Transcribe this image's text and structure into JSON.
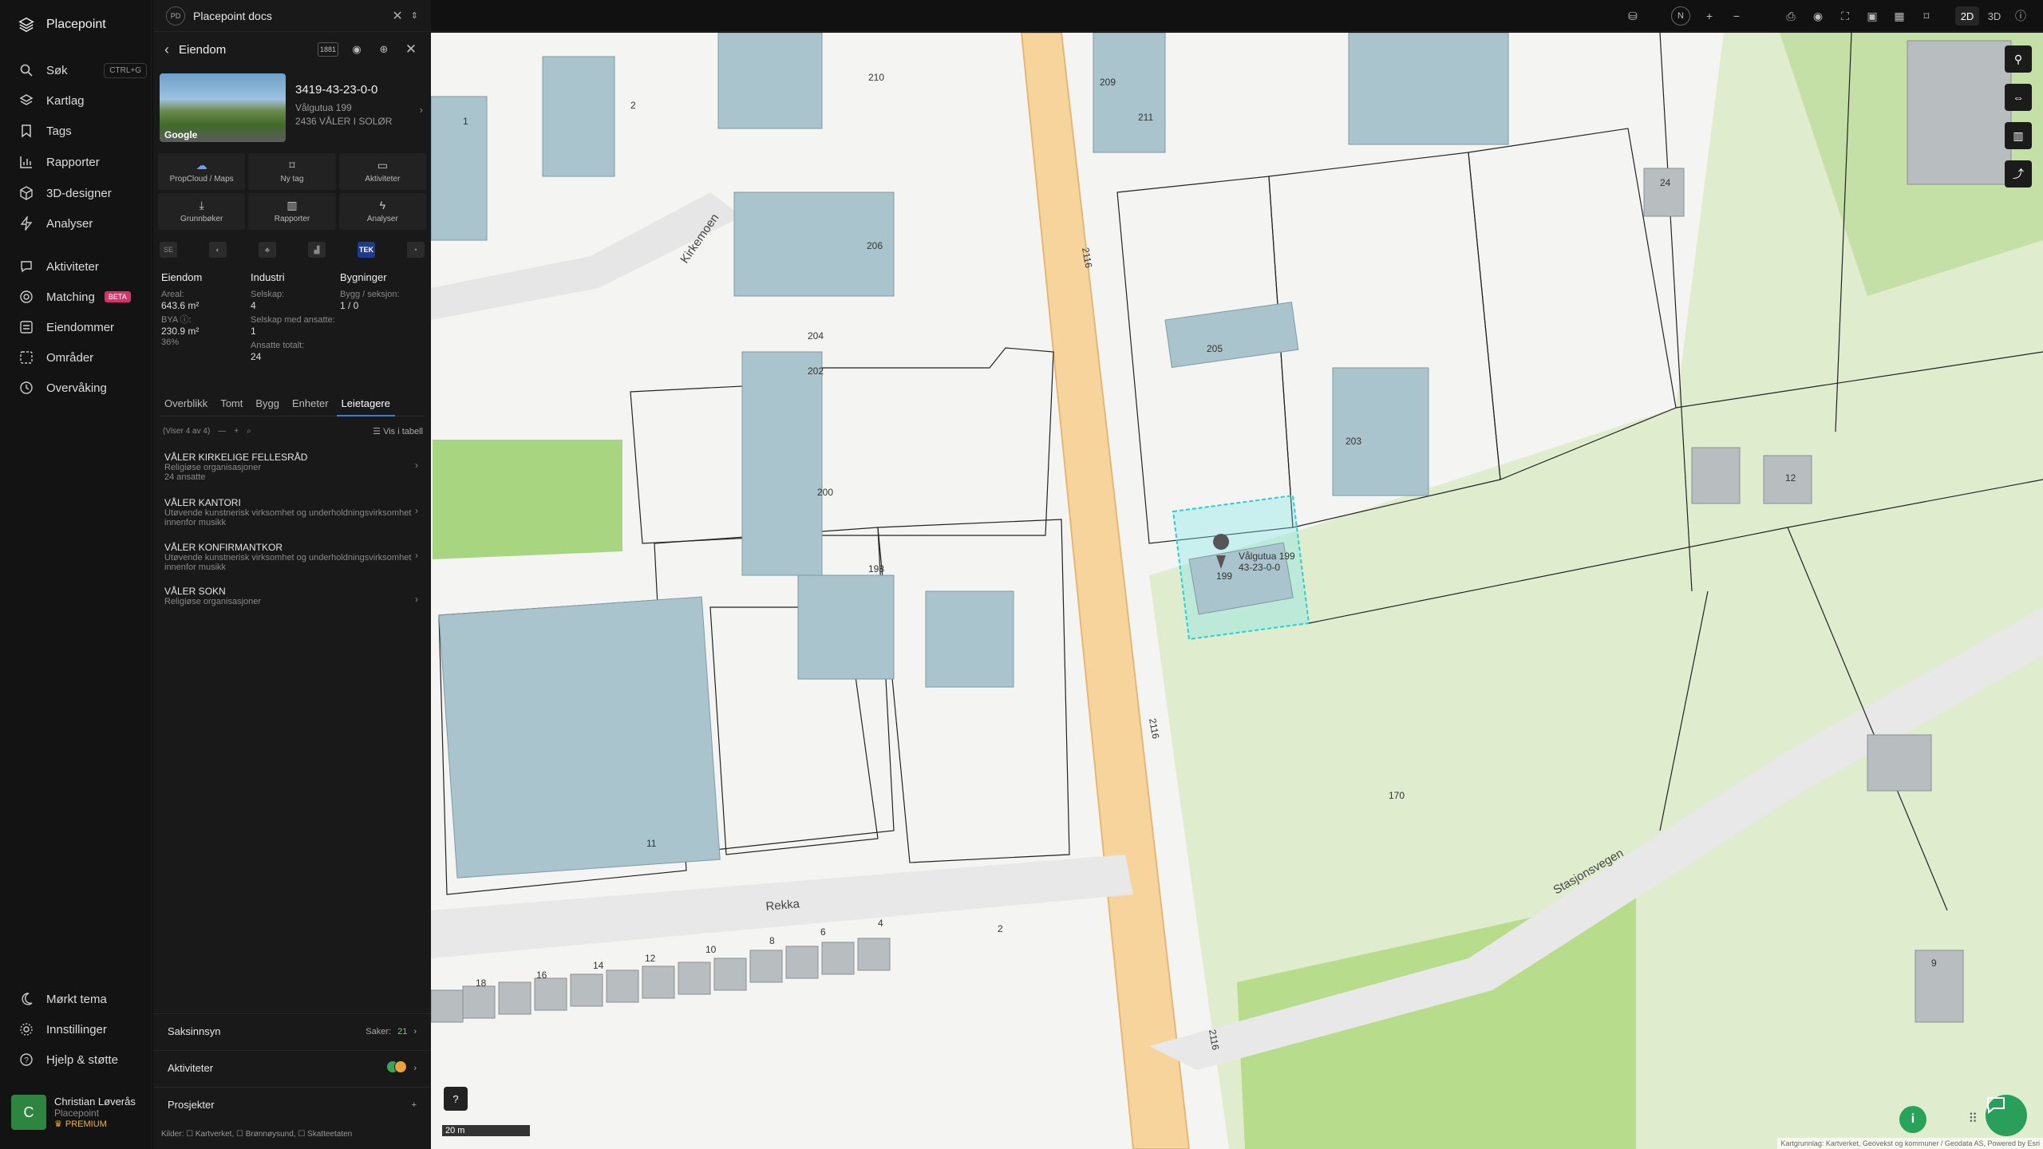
{
  "app": {
    "name": "Placepoint"
  },
  "nav": {
    "items": [
      {
        "label": "Søk",
        "icon": "search-icon",
        "shortcut": "CTRL+G"
      },
      {
        "label": "Kartlag",
        "icon": "layers-icon"
      },
      {
        "label": "Tags",
        "icon": "bookmark-icon"
      },
      {
        "label": "Rapporter",
        "icon": "chart-icon"
      },
      {
        "label": "3D-designer",
        "icon": "cube-icon"
      },
      {
        "label": "Analyser",
        "icon": "bolt-icon"
      },
      {
        "label": "Aktiviteter",
        "icon": "activity-icon"
      },
      {
        "label": "Matching",
        "icon": "target-icon",
        "badge": "BETA"
      },
      {
        "label": "Eiendommer",
        "icon": "list-icon"
      },
      {
        "label": "Områder",
        "icon": "area-icon"
      },
      {
        "label": "Overvåking",
        "icon": "monitor-icon"
      }
    ],
    "bottom": [
      {
        "label": "Mørkt tema",
        "icon": "moon-icon"
      },
      {
        "label": "Innstillinger",
        "icon": "gear-icon"
      },
      {
        "label": "Hjelp & støtte",
        "icon": "help-icon"
      }
    ],
    "user": {
      "initial": "C",
      "name": "Christian Løverås",
      "org": "Placepoint",
      "plan": "PREMIUM"
    }
  },
  "doc": {
    "badge": "PD",
    "title": "Placepoint docs"
  },
  "property": {
    "header": "Eiendom",
    "count_badge": "1881",
    "id": "3419-43-23-0-0",
    "street": "Vålgutua 199",
    "postal": "2436 VÅLER I SOLØR",
    "photo_label": "Google",
    "actions": [
      {
        "label": "PropCloud / Maps",
        "icon": "cloud-icon"
      },
      {
        "label": "Ny tag",
        "icon": "bookmark-icon"
      },
      {
        "label": "Aktiviteter",
        "icon": "comment-icon"
      },
      {
        "label": "Grunnbøker",
        "icon": "download-icon"
      },
      {
        "label": "Rapporter",
        "icon": "chart-icon"
      },
      {
        "label": "Analyser",
        "icon": "bolt-icon"
      }
    ],
    "layers": [
      "SE",
      "◐",
      "♣",
      "▟",
      "TEK",
      "•"
    ],
    "stats": {
      "eiendom": {
        "title": "Eiendom",
        "areal_label": "Areal:",
        "areal": "643.6 m²",
        "bya_label": "BYA ⓘ:",
        "bya": "230.9 m²",
        "bya_pct": "36%"
      },
      "industri": {
        "title": "Industri",
        "selskap_label": "Selskap:",
        "selskap": "4",
        "ansatte_label": "Selskap med ansatte:",
        "ansatte": "1",
        "totalt_label": "Ansatte totalt:",
        "totalt": "24"
      },
      "bygninger": {
        "title": "Bygninger",
        "label": "Bygg / seksjon:",
        "value": "1 / 0"
      }
    },
    "tabs": [
      "Overblikk",
      "Tomt",
      "Bygg",
      "Enheter",
      "Leietagere"
    ],
    "active_tab": "Leietagere",
    "list_info": "(Viser 4 av 4)",
    "table_toggle": "Vis i tabell",
    "tenants": [
      {
        "name": "VÅLER KIRKELIGE FELLESRÅD",
        "desc": "Religiøse organisasjoner",
        "extra": "24 ansatte"
      },
      {
        "name": "VÅLER KANTORI",
        "desc": "Utøvende kunstnerisk virksomhet og underholdningsvirksomhet innenfor musikk",
        "extra": ""
      },
      {
        "name": "VÅLER KONFIRMANTKOR",
        "desc": "Utøvende kunstnerisk virksomhet og underholdningsvirksomhet innenfor musikk",
        "extra": ""
      },
      {
        "name": "VÅLER SOKN",
        "desc": "Religiøse organisasjoner",
        "extra": ""
      }
    ],
    "sections": {
      "saksinnsyn": {
        "label": "Saksinnsyn",
        "count_label": "Saker:",
        "count": "21"
      },
      "aktiviteter": {
        "label": "Aktiviteter"
      },
      "prosjekter": {
        "label": "Prosjekter",
        "add": "+"
      }
    },
    "sources": "Kilder: ☐ Kartverket, ☐ Brønnøysund, ☐ Skatteetaten"
  },
  "toolbar": {
    "compass": "N",
    "mode_2d": "2D",
    "mode_3d": "3D"
  },
  "map": {
    "selected_label": "Vålgutua 199",
    "selected_id": "43-23-0-0",
    "roads": {
      "rekka": "Rekka",
      "stasjonsvegen": "Stasjonsvegen",
      "kirkemoen": "Kirkemoen",
      "road_no": "2116"
    },
    "house_numbers": [
      "1",
      "2",
      "209",
      "210",
      "211",
      "206",
      "204",
      "202",
      "200",
      "205",
      "203",
      "199",
      "198",
      "24",
      "12",
      "11",
      "2",
      "4",
      "6",
      "8",
      "10",
      "12",
      "14",
      "16",
      "18",
      "9"
    ],
    "contour": "170",
    "scale": "20 m",
    "attribution": "Kartgrunnlag: Kartverket, Geovekst og kommuner / Geodata AS, Powered by Esri"
  },
  "colors": {
    "accent": "#3d7bd9",
    "building": "#a9c4cc",
    "road": "#f7d9a3",
    "green": "#c9e3a8",
    "selection": "#26d1d1",
    "fab": "#2aa35a"
  }
}
